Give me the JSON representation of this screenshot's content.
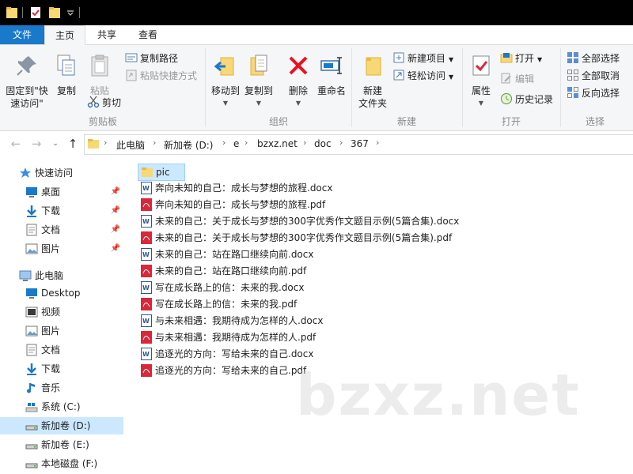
{
  "ribbon_tabs": [
    {
      "label": "文件"
    },
    {
      "label": "主页"
    },
    {
      "label": "共享"
    },
    {
      "label": "查看"
    }
  ],
  "ribbon": {
    "clipboard": {
      "group_label": "剪贴板",
      "pin_quick_access_line1": "固定到\"快",
      "pin_quick_access_line2": "速访问\"",
      "copy": "复制",
      "paste": "粘贴",
      "copy_path": "复制路径",
      "paste_shortcut": "粘贴快捷方式",
      "cut": "剪切"
    },
    "organize": {
      "group_label": "组织",
      "move_to": "移动到",
      "copy_to": "复制到",
      "delete": "删除",
      "rename": "重命名"
    },
    "new": {
      "group_label": "新建",
      "new_folder_line1": "新建",
      "new_folder_line2": "文件夹",
      "new_item": "新建项目",
      "easy_access": "轻松访问"
    },
    "open": {
      "group_label": "打开",
      "properties": "属性",
      "open": "打开",
      "edit": "编辑",
      "history": "历史记录"
    },
    "select": {
      "group_label": "选择",
      "select_all": "全部选择",
      "select_none": "全部取消",
      "invert": "反向选择"
    }
  },
  "address": {
    "crumbs": [
      "此电脑",
      "新加卷 (D:)",
      "e",
      "bzxz.net",
      "doc",
      "367"
    ]
  },
  "nav": [
    {
      "label": "快速访问",
      "icon": "star-icon",
      "pinned": false,
      "selected": false
    },
    {
      "label": "桌面",
      "icon": "desktop-icon",
      "pinned": true,
      "selected": false
    },
    {
      "label": "下载",
      "icon": "download-icon",
      "pinned": true,
      "selected": false
    },
    {
      "label": "文档",
      "icon": "document-icon",
      "pinned": true,
      "selected": false
    },
    {
      "label": "图片",
      "icon": "pictures-icon",
      "pinned": true,
      "selected": false
    },
    {
      "label": "此电脑",
      "icon": "computer-icon",
      "pinned": false,
      "selected": false
    },
    {
      "label": "Desktop",
      "icon": "desktop-icon",
      "pinned": false,
      "selected": false
    },
    {
      "label": "视频",
      "icon": "video-icon",
      "pinned": false,
      "selected": false
    },
    {
      "label": "图片",
      "icon": "pictures-icon",
      "pinned": false,
      "selected": false
    },
    {
      "label": "文档",
      "icon": "document-icon",
      "pinned": false,
      "selected": false
    },
    {
      "label": "下载",
      "icon": "download-icon",
      "pinned": false,
      "selected": false
    },
    {
      "label": "音乐",
      "icon": "music-icon",
      "pinned": false,
      "selected": false
    },
    {
      "label": "系统 (C:)",
      "icon": "windows-drive-icon",
      "pinned": false,
      "selected": false
    },
    {
      "label": "新加卷 (D:)",
      "icon": "drive-icon",
      "pinned": false,
      "selected": true
    },
    {
      "label": "新加卷 (E:)",
      "icon": "drive-icon",
      "pinned": false,
      "selected": false
    },
    {
      "label": "本地磁盘 (F:)",
      "icon": "drive-icon",
      "pinned": false,
      "selected": false
    }
  ],
  "files": [
    {
      "name": "pic",
      "type": "folder",
      "selected": true
    },
    {
      "name": "奔向未知的自己：成长与梦想的旅程.docx",
      "type": "docx",
      "selected": false
    },
    {
      "name": "奔向未知的自己：成长与梦想的旅程.pdf",
      "type": "pdf",
      "selected": false
    },
    {
      "name": "未来的自己：关于成长与梦想的300字优秀作文题目示例(5篇合集).docx",
      "type": "docx",
      "selected": false
    },
    {
      "name": "未来的自己：关于成长与梦想的300字优秀作文题目示例(5篇合集).pdf",
      "type": "pdf",
      "selected": false
    },
    {
      "name": "未来的自己：站在路口继续向前.docx",
      "type": "docx",
      "selected": false
    },
    {
      "name": "未来的自己：站在路口继续向前.pdf",
      "type": "pdf",
      "selected": false
    },
    {
      "name": "写在成长路上的信：未来的我.docx",
      "type": "docx",
      "selected": false
    },
    {
      "name": "写在成长路上的信：未来的我.pdf",
      "type": "pdf",
      "selected": false
    },
    {
      "name": "与未来相遇：我期待成为怎样的人.docx",
      "type": "docx",
      "selected": false
    },
    {
      "name": "与未来相遇：我期待成为怎样的人.pdf",
      "type": "pdf",
      "selected": false
    },
    {
      "name": "追逐光的方向：写给未来的自己.docx",
      "type": "docx",
      "selected": false
    },
    {
      "name": "追逐光的方向：写给未来的自己.pdf",
      "type": "pdf",
      "selected": false
    }
  ],
  "watermark": "bzxz.net",
  "colors": {
    "accent": "#1979ca",
    "selection": "#cce8ff",
    "folder": "#f8d775",
    "pdf": "#d9283a",
    "docx": "#2b5797",
    "delete": "#e81123"
  }
}
